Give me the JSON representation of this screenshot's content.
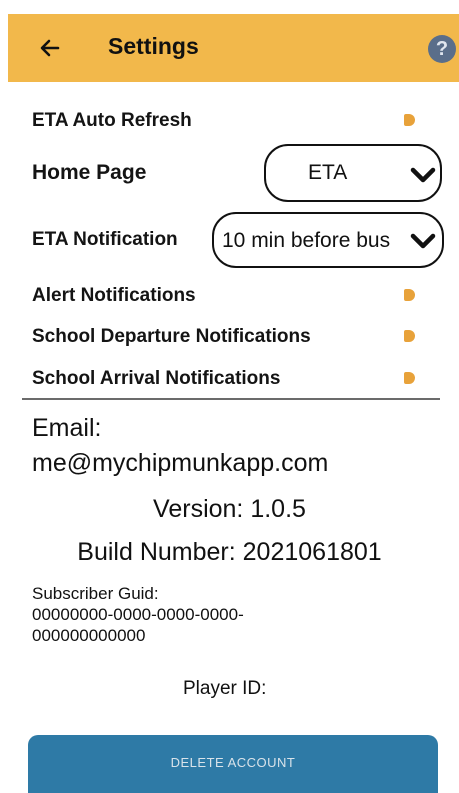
{
  "header": {
    "title": "Settings",
    "back_icon": "arrow-left-icon",
    "help_icon": "help-icon",
    "help_glyph": "?",
    "background_color": "#f2b84b"
  },
  "settings": {
    "eta_auto_refresh": {
      "label": "ETA Auto Refresh",
      "enabled": true
    },
    "home_page": {
      "label": "Home Page",
      "value": "ETA"
    },
    "eta_notification": {
      "label": "ETA Notification",
      "value": "10 min before bus"
    },
    "alert_notifications": {
      "label": "Alert Notifications",
      "enabled": true
    },
    "school_departure_notifications": {
      "label": "School Departure Notifications",
      "enabled": true
    },
    "school_arrival_notifications": {
      "label": "School Arrival Notifications",
      "enabled": true
    },
    "toggle_color": "#e8a23a"
  },
  "account": {
    "email_label": "Email:",
    "email_value": "me@mychipmunkapp.com",
    "version": "Version: 1.0.5",
    "build_number": "Build Number: 2021061801",
    "subscriber_label": "Subscriber Guid:",
    "subscriber_line1": "00000000-0000-0000-0000-",
    "subscriber_line2": "000000000000",
    "player_id_label": "Player ID:"
  },
  "actions": {
    "delete_account_label": "DELETE ACCOUNT",
    "delete_button_color": "#2e7aa6"
  }
}
